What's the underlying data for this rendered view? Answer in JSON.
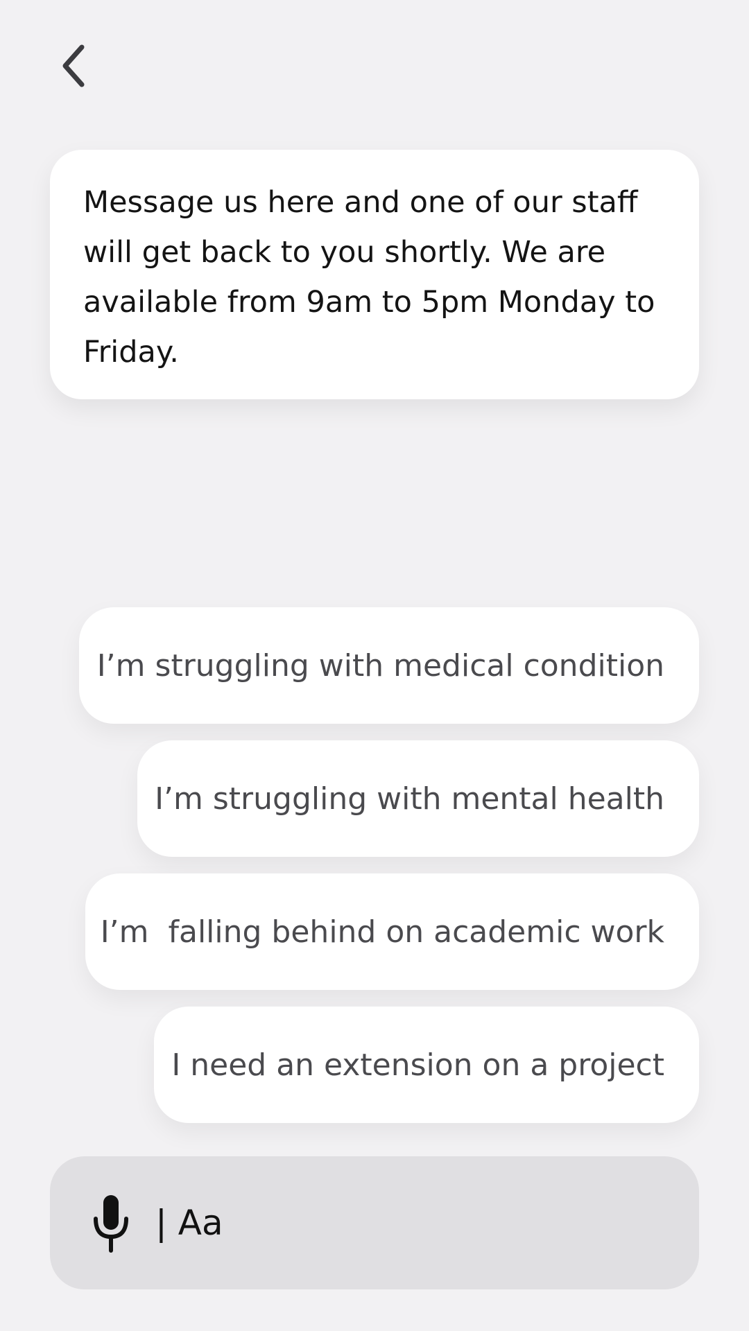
{
  "header": {
    "back_icon": "chevron-left-icon"
  },
  "info_message": {
    "text": "Message us here and one of our staff will get back to you shortly. We are available from 9am to 5pm Monday to Friday."
  },
  "suggestions": [
    {
      "label": "I’m struggling with medical condition"
    },
    {
      "label": "I’m struggling with mental health"
    },
    {
      "label": "I’m  falling behind on academic work"
    },
    {
      "label": "I need an extension on a project"
    }
  ],
  "composer": {
    "mic_icon": "microphone-icon",
    "placeholder": "| Aa"
  },
  "colors": {
    "background": "#f2f1f3",
    "card": "#ffffff",
    "composer_bg": "#e0dfe2",
    "chip_text": "#4a4a4e"
  }
}
